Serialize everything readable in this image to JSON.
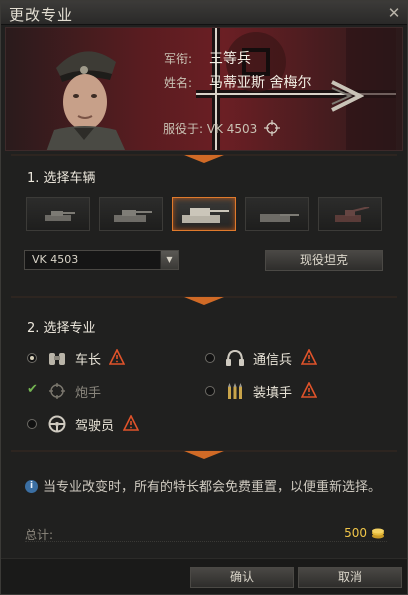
{
  "window": {
    "title": "更改专业"
  },
  "crew_member": {
    "rank_label": "军衔:",
    "rank_value": "三等兵",
    "name_label": "姓名:",
    "name_value": "马蒂亚斯 舍梅尔",
    "serving_label": "服役于: VK 4503"
  },
  "section1": {
    "title": "1. 选择车辆",
    "tank_tiles": [
      "light-tank-1",
      "medium-tank-1",
      "heavy-tank-selected",
      "tank-destroyer",
      "spg"
    ],
    "selected_index": 2
  },
  "vehicle_dropdown": {
    "selected": "VK 4503"
  },
  "current_tank_button": "现役坦克",
  "section2": {
    "title": "2. 选择专业",
    "roles": [
      {
        "label": "车长",
        "icon": "binoculars-icon",
        "state": "selected",
        "warning": true
      },
      {
        "label": "通信兵",
        "icon": "headphones-icon",
        "state": "unselected",
        "warning": true
      },
      {
        "label": "炮手",
        "icon": "crosshair-icon",
        "state": "current",
        "warning": false
      },
      {
        "label": "装填手",
        "icon": "shells-icon",
        "state": "unselected",
        "warning": true
      },
      {
        "label": "驾驶员",
        "icon": "steering-wheel-icon",
        "state": "unselected",
        "warning": true
      }
    ]
  },
  "notice": "当专业改变时，所有的特长都会免费重置，以便重新选择。",
  "total": {
    "label": "总计:",
    "value": "500"
  },
  "buttons": {
    "confirm": "确认",
    "cancel": "取消"
  },
  "colors": {
    "accent": "#e07a2c",
    "warning": "#e0532a",
    "gold": "#f0c548",
    "info": "#3b6fa3"
  }
}
